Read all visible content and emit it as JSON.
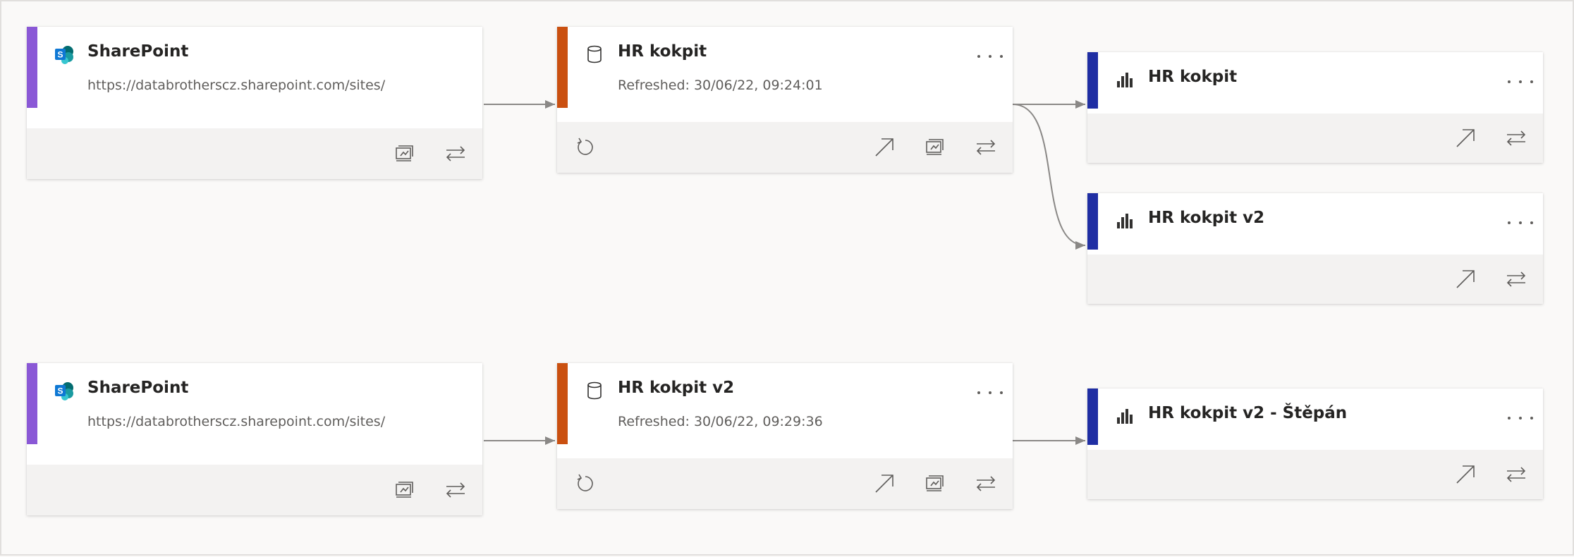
{
  "lineage": {
    "row1": {
      "source": {
        "title": "SharePoint",
        "url": "https://databrotherscz.sharepoint.com/sites/"
      },
      "dataset": {
        "title": "HR kokpit",
        "refreshed": "Refreshed: 30/06/22, 09:24:01"
      },
      "reports": [
        {
          "title": "HR kokpit"
        },
        {
          "title": "HR kokpit v2"
        }
      ]
    },
    "row2": {
      "source": {
        "title": "SharePoint",
        "url": "https://databrotherscz.sharepoint.com/sites/"
      },
      "dataset": {
        "title": "HR kokpit v2",
        "refreshed": "Refreshed: 30/06/22, 09:29:36"
      },
      "reports": [
        {
          "title": "HR kokpit v2 - Štěpán"
        }
      ]
    }
  },
  "icons": {
    "source": "sharepoint-icon",
    "dataset": "dataset-cylinder-icon",
    "report": "bar-chart-icon",
    "refresh": "refresh-icon",
    "open": "open-arrow-icon",
    "impact": "impact-analysis-icon",
    "lineage": "lineage-arrows-icon",
    "more": "more-options-icon"
  },
  "colors": {
    "source_accent": "#8a58d6",
    "dataset_accent": "#ca5010",
    "report_accent": "#1f2ea3",
    "sharepoint_blue": "#0f78d4",
    "connector": "#8a8886"
  }
}
